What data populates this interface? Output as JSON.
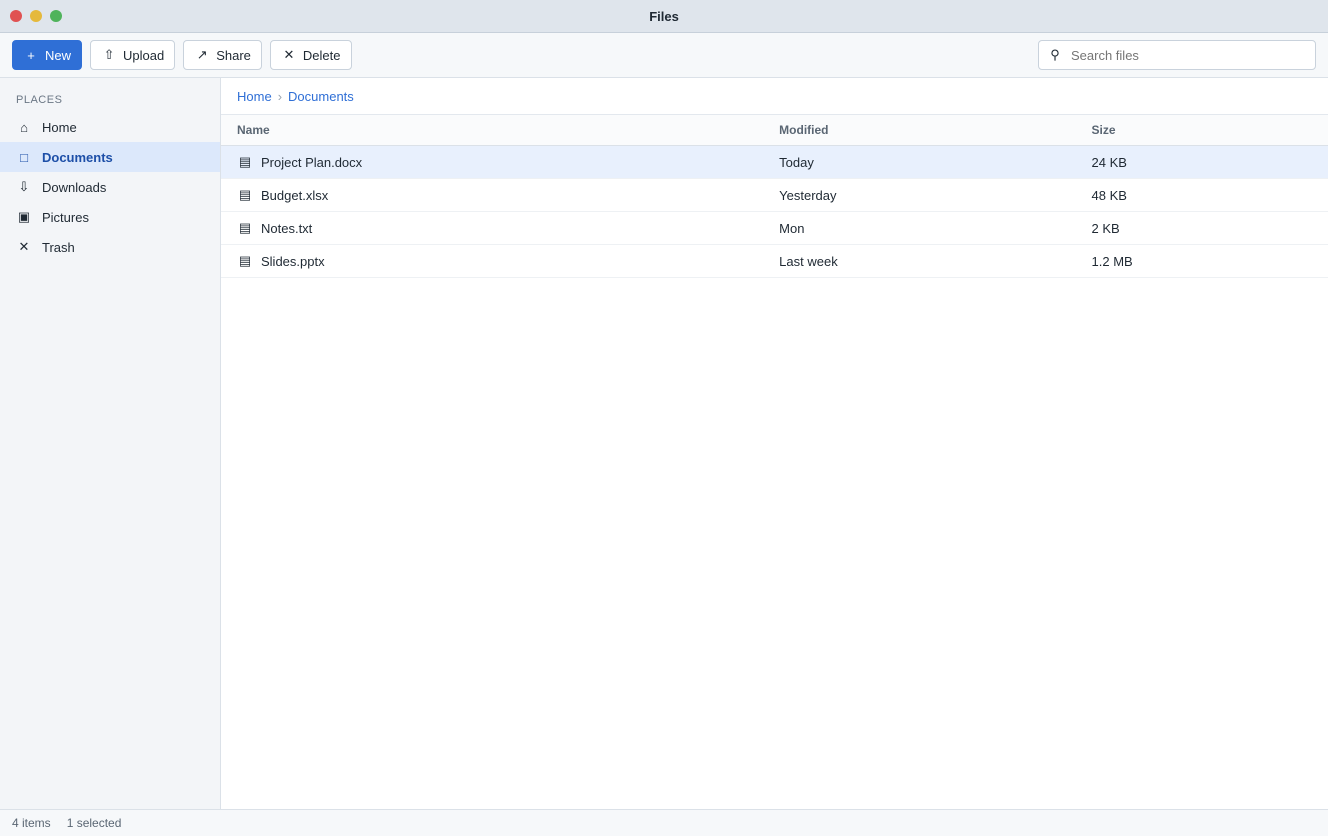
{
  "window": {
    "title": "Files"
  },
  "toolbar": {
    "new_label": "New",
    "upload_label": "Upload",
    "share_label": "Share",
    "delete_label": "Delete"
  },
  "search": {
    "placeholder": "Search files",
    "value": ""
  },
  "sidebar": {
    "heading": "Places",
    "items": [
      {
        "label": "Home",
        "icon": "home-icon"
      },
      {
        "label": "Documents",
        "icon": "folder-icon"
      },
      {
        "label": "Downloads",
        "icon": "download-icon"
      },
      {
        "label": "Pictures",
        "icon": "image-icon"
      },
      {
        "label": "Trash",
        "icon": "trash-icon"
      }
    ]
  },
  "breadcrumb": [
    "Home",
    "Documents"
  ],
  "table": {
    "headers": [
      "Name",
      "Modified",
      "Size"
    ],
    "rows": [
      {
        "name": "Project Plan.docx",
        "modified": "Today",
        "size": "24 KB"
      },
      {
        "name": "Budget.xlsx",
        "modified": "Yesterday",
        "size": "48 KB"
      },
      {
        "name": "Notes.txt",
        "modified": "Mon",
        "size": "2 KB"
      },
      {
        "name": "Slides.pptx",
        "modified": "Last week",
        "size": "1.2 MB"
      }
    ]
  },
  "status": {
    "count": "4 items",
    "selection": "1 selected"
  },
  "colors": {
    "accent": "#2f6fd6",
    "selection": "#e8f0fd"
  }
}
